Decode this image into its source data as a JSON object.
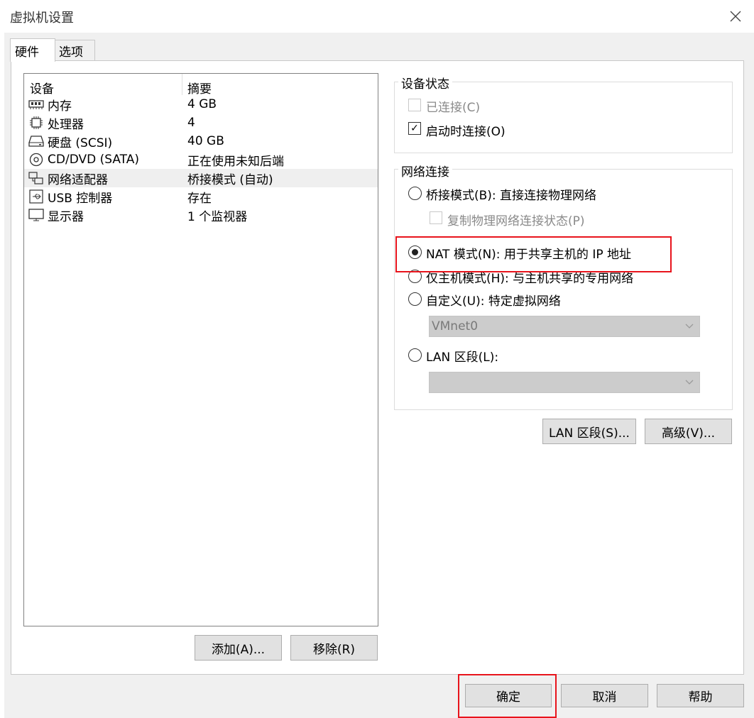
{
  "window": {
    "title": "虚拟机设置"
  },
  "tabs": [
    {
      "label": "硬件"
    },
    {
      "label": "选项"
    }
  ],
  "devices": {
    "header": {
      "device": "设备",
      "summary": "摘要"
    },
    "items": [
      {
        "name": "内存",
        "summary": "4 GB",
        "icon": "memory-icon"
      },
      {
        "name": "处理器",
        "summary": "4",
        "icon": "processor-icon"
      },
      {
        "name": "硬盘 (SCSI)",
        "summary": "40 GB",
        "icon": "hard-disk-icon"
      },
      {
        "name": "CD/DVD (SATA)",
        "summary": "正在使用未知后端",
        "icon": "cd-dvd-icon"
      },
      {
        "name": "网络适配器",
        "summary": "桥接模式 (自动)",
        "icon": "network-adapter-icon",
        "selected": true
      },
      {
        "name": "USB 控制器",
        "summary": "存在",
        "icon": "usb-icon"
      },
      {
        "name": "显示器",
        "summary": "1 个监视器",
        "icon": "display-icon"
      }
    ],
    "add_label": "添加(A)...",
    "remove_label": "移除(R)"
  },
  "device_status": {
    "title": "设备状态",
    "connected": {
      "label": "已连接(C)",
      "checked": false,
      "disabled": true
    },
    "connect_at_power_on": {
      "label": "启动时连接(O)",
      "checked": true
    }
  },
  "network": {
    "title": "网络连接",
    "bridged": {
      "label": "桥接模式(B): 直接连接物理网络",
      "selected": false
    },
    "replicate": {
      "label": "复制物理网络连接状态(P)",
      "checked": false,
      "disabled": true
    },
    "nat": {
      "label": "NAT 模式(N): 用于共享主机的 IP 地址",
      "selected": true
    },
    "host_only": {
      "label": "仅主机模式(H): 与主机共享的专用网络",
      "selected": false
    },
    "custom": {
      "label": "自定义(U): 特定虚拟网络",
      "selected": false
    },
    "custom_select": {
      "value": "VMnet0"
    },
    "lan": {
      "label": "LAN 区段(L):",
      "selected": false
    },
    "lan_select": {
      "value": ""
    }
  },
  "buttons": {
    "lan_segments": "LAN 区段(S)...",
    "advanced": "高级(V)...",
    "ok": "确定",
    "cancel": "取消",
    "help": "帮助"
  },
  "highlight_color": "#e8141c"
}
